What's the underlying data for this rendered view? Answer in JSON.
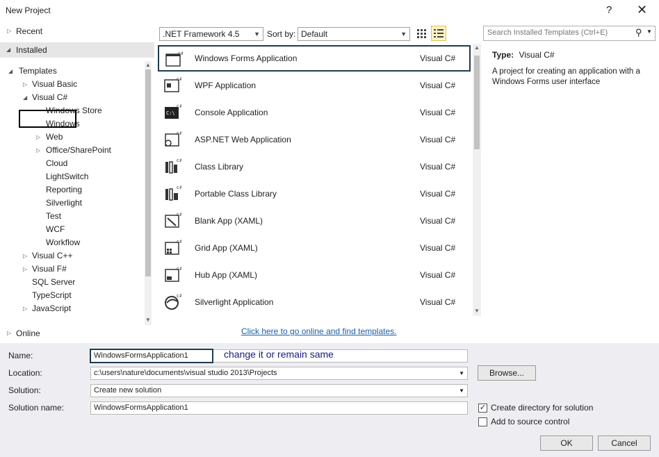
{
  "window": {
    "title": "New Project",
    "help_glyph": "?",
    "close_glyph": "✕"
  },
  "left_pane": {
    "recent": "Recent",
    "installed": "Installed",
    "online": "Online",
    "tree": {
      "templates": "Templates",
      "visual_basic": "Visual Basic",
      "visual_csharp": "Visual C#",
      "csharp_children": [
        "Windows Store",
        "Windows",
        "Web",
        "Office/SharePoint",
        "Cloud",
        "LightSwitch",
        "Reporting",
        "Silverlight",
        "Test",
        "WCF",
        "Workflow"
      ],
      "other_languages": [
        "Visual C++",
        "Visual F#",
        "SQL Server",
        "TypeScript",
        "JavaScript"
      ]
    }
  },
  "toolbar": {
    "framework": ".NET Framework 4.5",
    "sort_by_label": "Sort by:",
    "sort_value": "Default"
  },
  "templates": [
    {
      "name": "Windows Forms Application",
      "lang": "Visual C#",
      "icon": "windows-forms-icon"
    },
    {
      "name": "WPF Application",
      "lang": "Visual C#",
      "icon": "wpf-icon"
    },
    {
      "name": "Console Application",
      "lang": "Visual C#",
      "icon": "console-icon"
    },
    {
      "name": "ASP.NET Web Application",
      "lang": "Visual C#",
      "icon": "web-app-icon"
    },
    {
      "name": "Class Library",
      "lang": "Visual C#",
      "icon": "class-library-icon"
    },
    {
      "name": "Portable Class Library",
      "lang": "Visual C#",
      "icon": "portable-library-icon"
    },
    {
      "name": "Blank App (XAML)",
      "lang": "Visual C#",
      "icon": "blank-app-icon"
    },
    {
      "name": "Grid App (XAML)",
      "lang": "Visual C#",
      "icon": "grid-app-icon"
    },
    {
      "name": "Hub App (XAML)",
      "lang": "Visual C#",
      "icon": "hub-app-icon"
    },
    {
      "name": "Silverlight Application",
      "lang": "Visual C#",
      "icon": "silverlight-icon"
    }
  ],
  "online_link": "Click here to go online and find templates.",
  "right_pane": {
    "search_placeholder": "Search Installed Templates (Ctrl+E)",
    "type_label": "Type:",
    "type_value": "Visual C#",
    "description": "A project for creating an application with a Windows Forms user interface"
  },
  "form": {
    "name_label": "Name:",
    "name_value": "WindowsFormsApplication1",
    "annotation": "change it or remain same",
    "location_label": "Location:",
    "location_value": "c:\\users\\nature\\documents\\visual studio 2013\\Projects",
    "solution_label": "Solution:",
    "solution_value": "Create new solution",
    "solution_name_label": "Solution name:",
    "solution_name_value": "WindowsFormsApplication1",
    "browse_label": "Browse...",
    "create_dir_label": "Create directory for solution",
    "create_dir_checked": true,
    "source_control_label": "Add to source control",
    "source_control_checked": false,
    "ok_label": "OK",
    "cancel_label": "Cancel"
  }
}
